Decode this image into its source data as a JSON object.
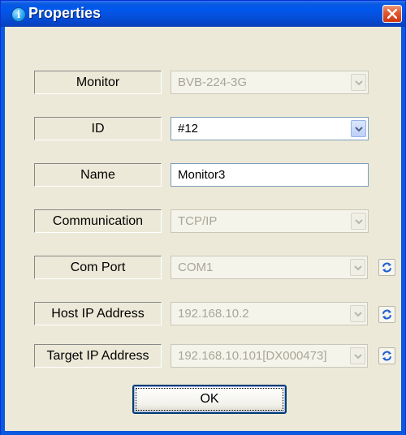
{
  "window": {
    "title": "Properties",
    "title_icon": "info-icon",
    "close_icon": "close-icon"
  },
  "colors": {
    "titlebar": "#0058ee",
    "frame": "#0a59e0",
    "dialog_bg": "#ece9d8",
    "close": "#e35a30",
    "refresh": "#1f5ed3"
  },
  "fields": {
    "monitor": {
      "label": "Monitor",
      "value": "BVB-224-3G",
      "enabled": false
    },
    "id": {
      "label": "ID",
      "value": "#12",
      "enabled": true
    },
    "name": {
      "label": "Name",
      "value": "Monitor3",
      "enabled": true
    },
    "communication": {
      "label": "Communication",
      "value": "TCP/IP",
      "enabled": false
    },
    "com_port": {
      "label": "Com Port",
      "value": "COM1",
      "enabled": false
    },
    "host_ip": {
      "label": "Host IP Address",
      "value": "192.168.10.2",
      "enabled": false
    },
    "target_ip": {
      "label": "Target IP Address",
      "value": "192.168.10.101[DX000473]",
      "enabled": false
    }
  },
  "buttons": {
    "ok": "OK",
    "refresh_icon": "refresh-icon"
  }
}
